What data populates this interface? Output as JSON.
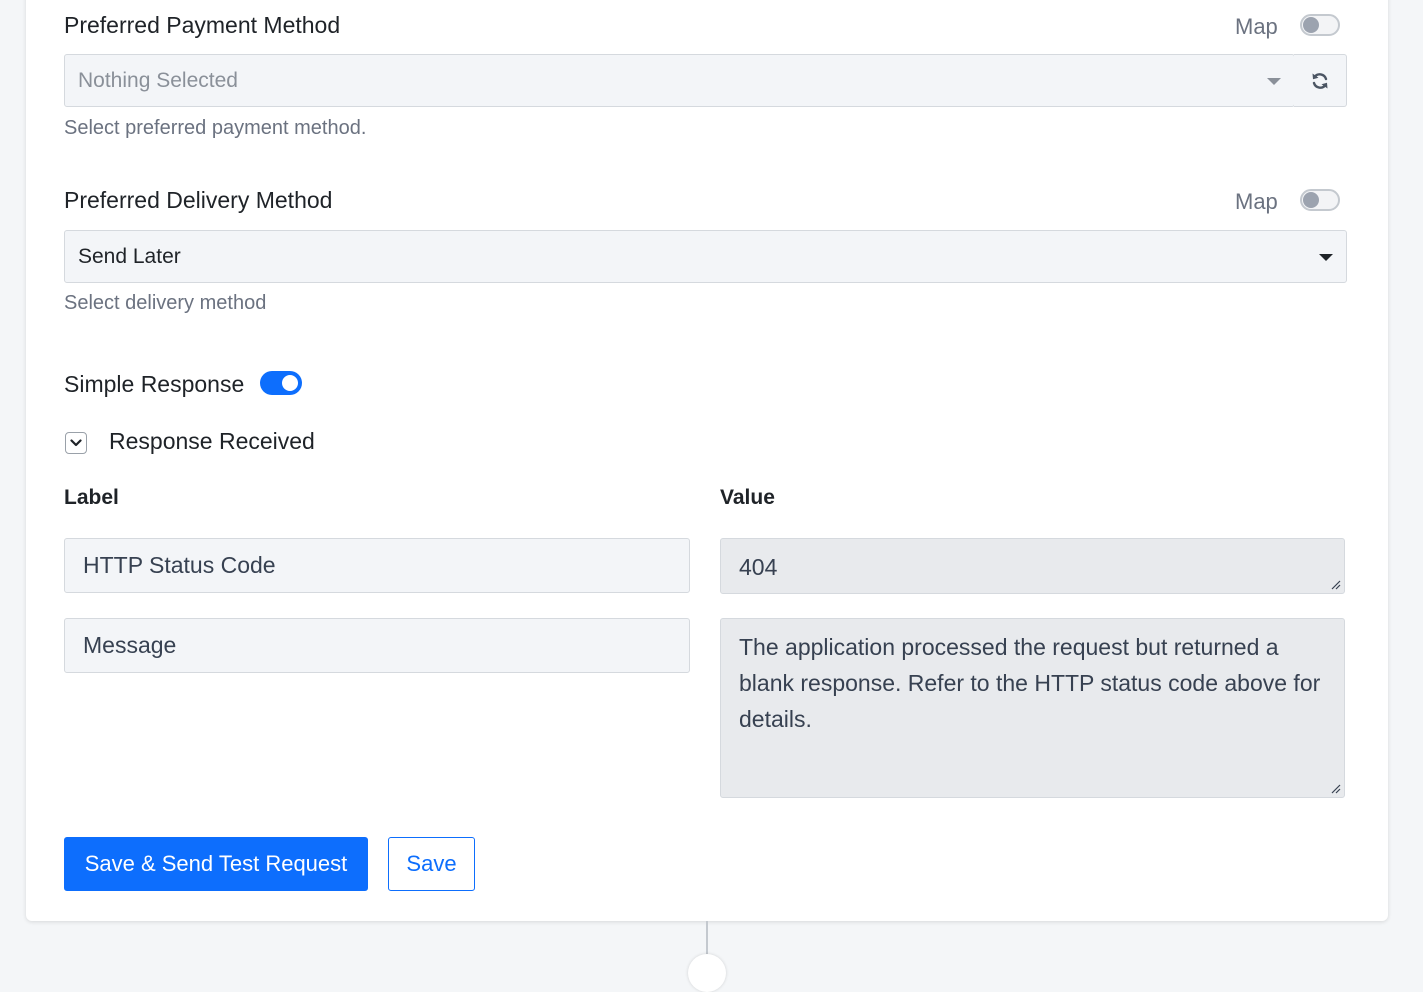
{
  "payment": {
    "title": "Preferred Payment Method",
    "map_label": "Map",
    "map_enabled": false,
    "selected": "Nothing Selected",
    "help": "Select preferred payment method."
  },
  "delivery": {
    "title": "Preferred Delivery Method",
    "map_label": "Map",
    "map_enabled": false,
    "selected": "Send Later",
    "help": "Select delivery method"
  },
  "simple_response": {
    "label": "Simple Response",
    "enabled": true
  },
  "response_received": {
    "label": "Response Received",
    "expanded": true
  },
  "table": {
    "label_header": "Label",
    "value_header": "Value",
    "rows": [
      {
        "label": "HTTP Status Code",
        "value": "404"
      },
      {
        "label": "Message",
        "value": "The application processed the request but returned a blank response.  Refer to the HTTP status code above for details."
      }
    ]
  },
  "actions": {
    "primary": "Save & Send Test Request",
    "secondary": "Save"
  },
  "colors": {
    "accent": "#0d6efd",
    "field_bg": "#f3f5f8",
    "readonly_bg": "#e8eaed"
  },
  "icons": [
    "refresh-icon",
    "dropdown-caret-icon",
    "chevron-down-icon",
    "resize-grip-icon"
  ]
}
